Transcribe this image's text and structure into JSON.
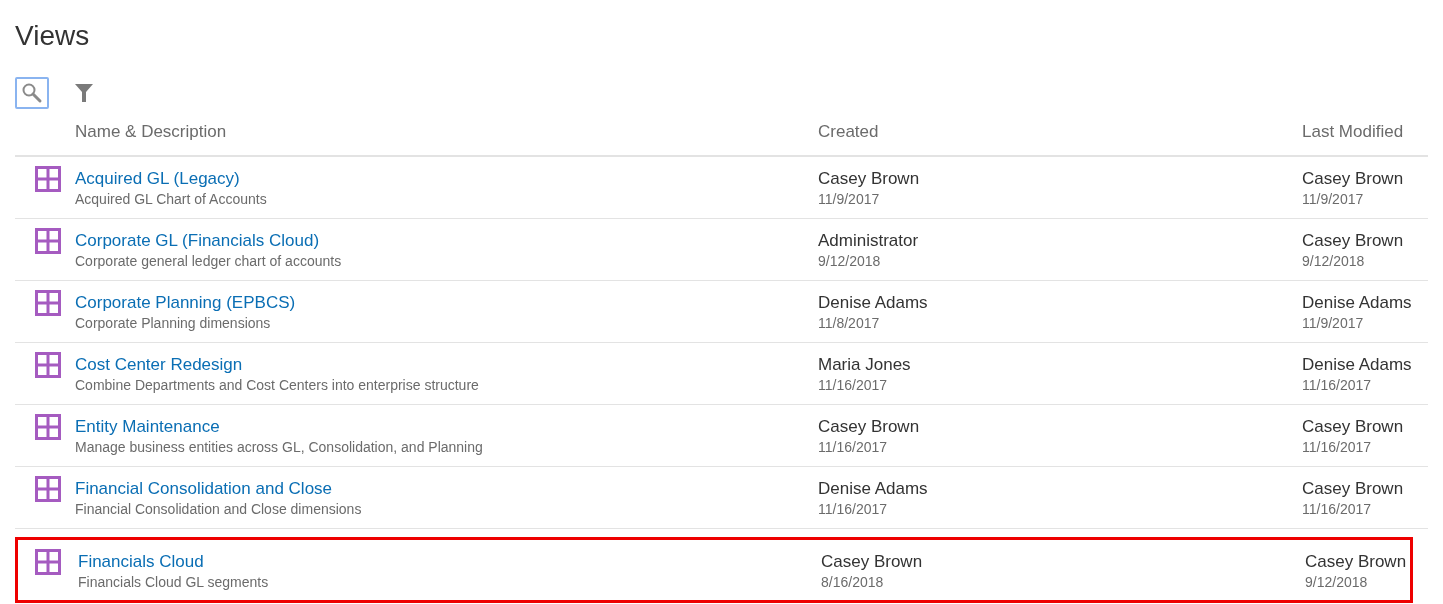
{
  "title": "Views",
  "toolbar": {
    "search_active": true
  },
  "columns": [
    "Name & Description",
    "Created",
    "Last Modified"
  ],
  "rows": [
    {
      "name": "Acquired GL (Legacy)",
      "description": "Acquired GL Chart of Accounts",
      "created_by": "Casey Brown",
      "created_date": "11/9/2017",
      "modified_by": "Casey Brown",
      "modified_date": "11/9/2017",
      "highlighted": false
    },
    {
      "name": "Corporate GL (Financials Cloud)",
      "description": "Corporate general ledger chart of accounts",
      "created_by": "Administrator",
      "created_date": "9/12/2018",
      "modified_by": "Casey Brown",
      "modified_date": "9/12/2018",
      "highlighted": false
    },
    {
      "name": "Corporate Planning (EPBCS)",
      "description": "Corporate Planning dimensions",
      "created_by": "Denise Adams",
      "created_date": "11/8/2017",
      "modified_by": "Denise Adams",
      "modified_date": "11/9/2017",
      "highlighted": false
    },
    {
      "name": "Cost Center Redesign",
      "description": "Combine Departments and Cost Centers into enterprise structure",
      "created_by": "Maria Jones",
      "created_date": "11/16/2017",
      "modified_by": "Denise Adams",
      "modified_date": "11/16/2017",
      "highlighted": false
    },
    {
      "name": "Entity Maintenance",
      "description": "Manage business entities across GL, Consolidation, and Planning",
      "created_by": "Casey Brown",
      "created_date": "11/16/2017",
      "modified_by": "Casey Brown",
      "modified_date": "11/16/2017",
      "highlighted": false
    },
    {
      "name": "Financial Consolidation and Close",
      "description": "Financial Consolidation and Close dimensions",
      "created_by": "Denise Adams",
      "created_date": "11/16/2017",
      "modified_by": "Casey Brown",
      "modified_date": "11/16/2017",
      "highlighted": false
    },
    {
      "name": "Financials Cloud",
      "description": "Financials Cloud GL segments",
      "created_by": "Casey Brown",
      "created_date": "8/16/2018",
      "modified_by": "Casey Brown",
      "modified_date": "9/12/2018",
      "highlighted": true
    }
  ]
}
